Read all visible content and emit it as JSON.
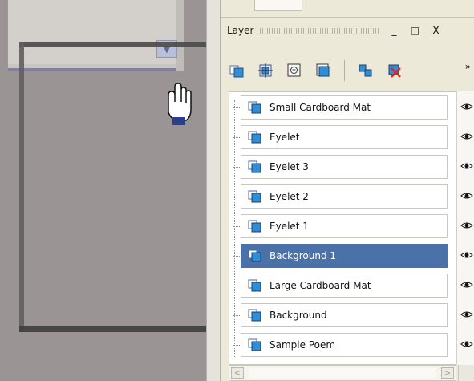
{
  "panel": {
    "title": "Layer",
    "minimize_label": "_",
    "maximize_label": "□",
    "close_label": "X",
    "more_label": "»"
  },
  "toolbar": {
    "icons": [
      "new-layer-icon",
      "group-icon",
      "mask-icon",
      "duplicate-icon",
      "arrange-icon",
      "delete-icon"
    ]
  },
  "layers": [
    {
      "name": "Small Cardboard Mat",
      "selected": false
    },
    {
      "name": "Eyelet",
      "selected": false
    },
    {
      "name": "Eyelet 3",
      "selected": false
    },
    {
      "name": "Eyelet 2",
      "selected": false
    },
    {
      "name": "Eyelet 1",
      "selected": false
    },
    {
      "name": "Background 1",
      "selected": true
    },
    {
      "name": "Large Cardboard Mat",
      "selected": false
    },
    {
      "name": "Background",
      "selected": false
    },
    {
      "name": "Sample Poem",
      "selected": false
    }
  ],
  "colors": {
    "selection": "#4a71a8",
    "panel_bg": "#ece9d8",
    "left_bg": "#9b9494",
    "accent_blue": "#2e8ed8"
  }
}
